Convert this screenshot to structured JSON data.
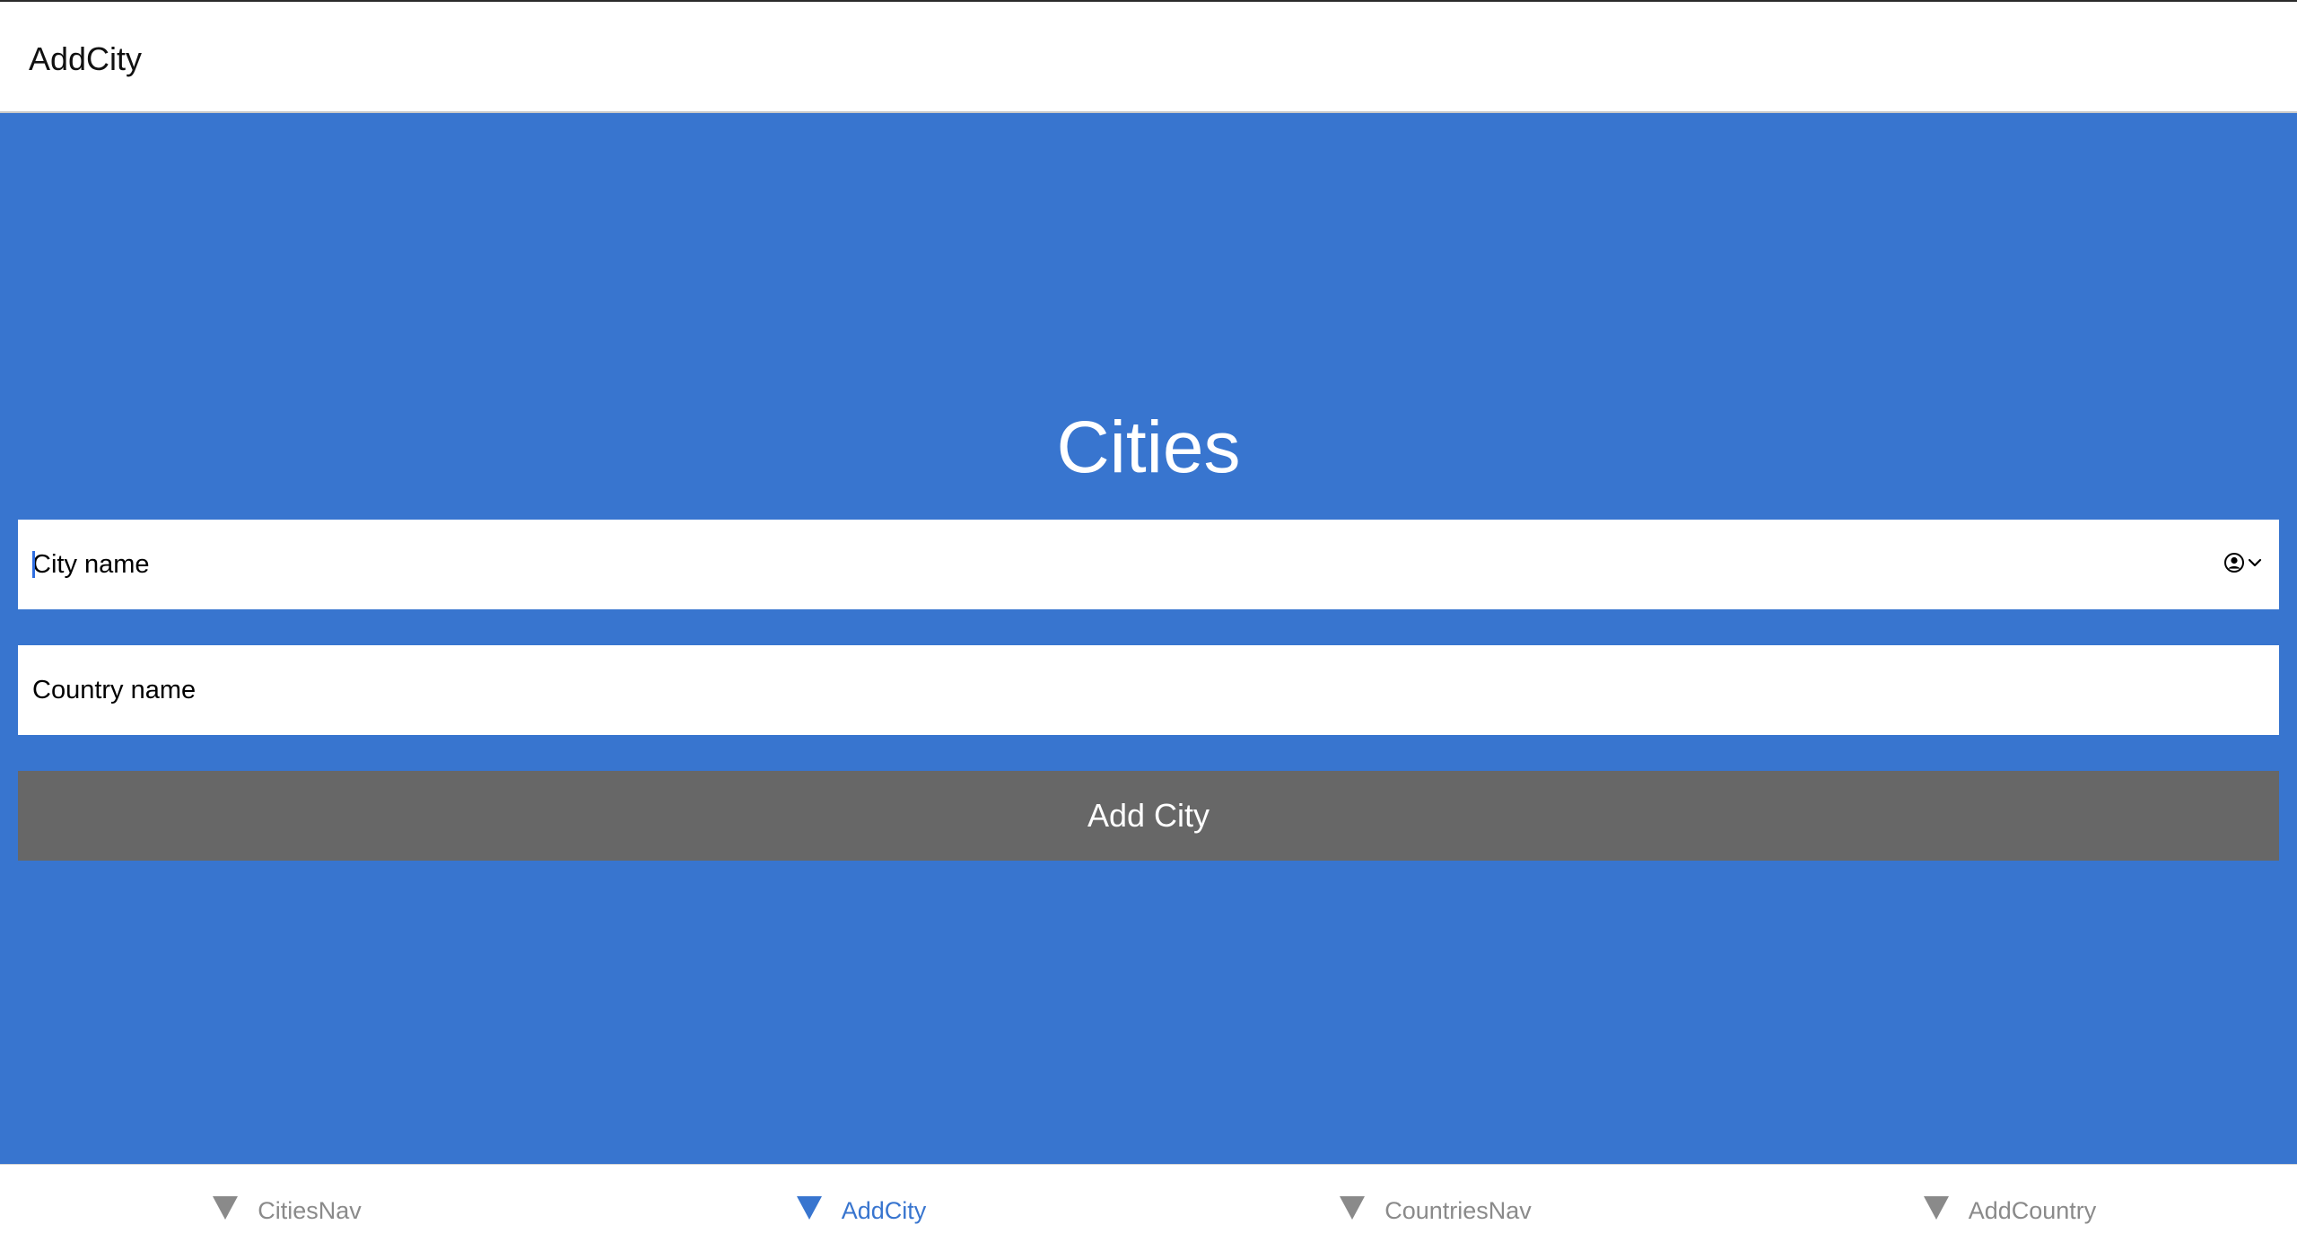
{
  "header": {
    "title": "AddCity"
  },
  "main": {
    "title": "Cities",
    "city_field": {
      "placeholder": "City name",
      "value": ""
    },
    "country_field": {
      "placeholder": "Country name",
      "value": ""
    },
    "add_button_label": "Add City"
  },
  "tabbar": {
    "active": "AddCity",
    "tabs": [
      {
        "label": "CitiesNav",
        "icon": "triangle-down-icon"
      },
      {
        "label": "AddCity",
        "icon": "triangle-down-icon"
      },
      {
        "label": "CountriesNav",
        "icon": "triangle-down-icon"
      },
      {
        "label": "AddCountry",
        "icon": "triangle-down-icon"
      }
    ]
  },
  "colors": {
    "accent": "#3875cf",
    "button": "#676767",
    "inactive_tab": "#8a8a8a"
  }
}
